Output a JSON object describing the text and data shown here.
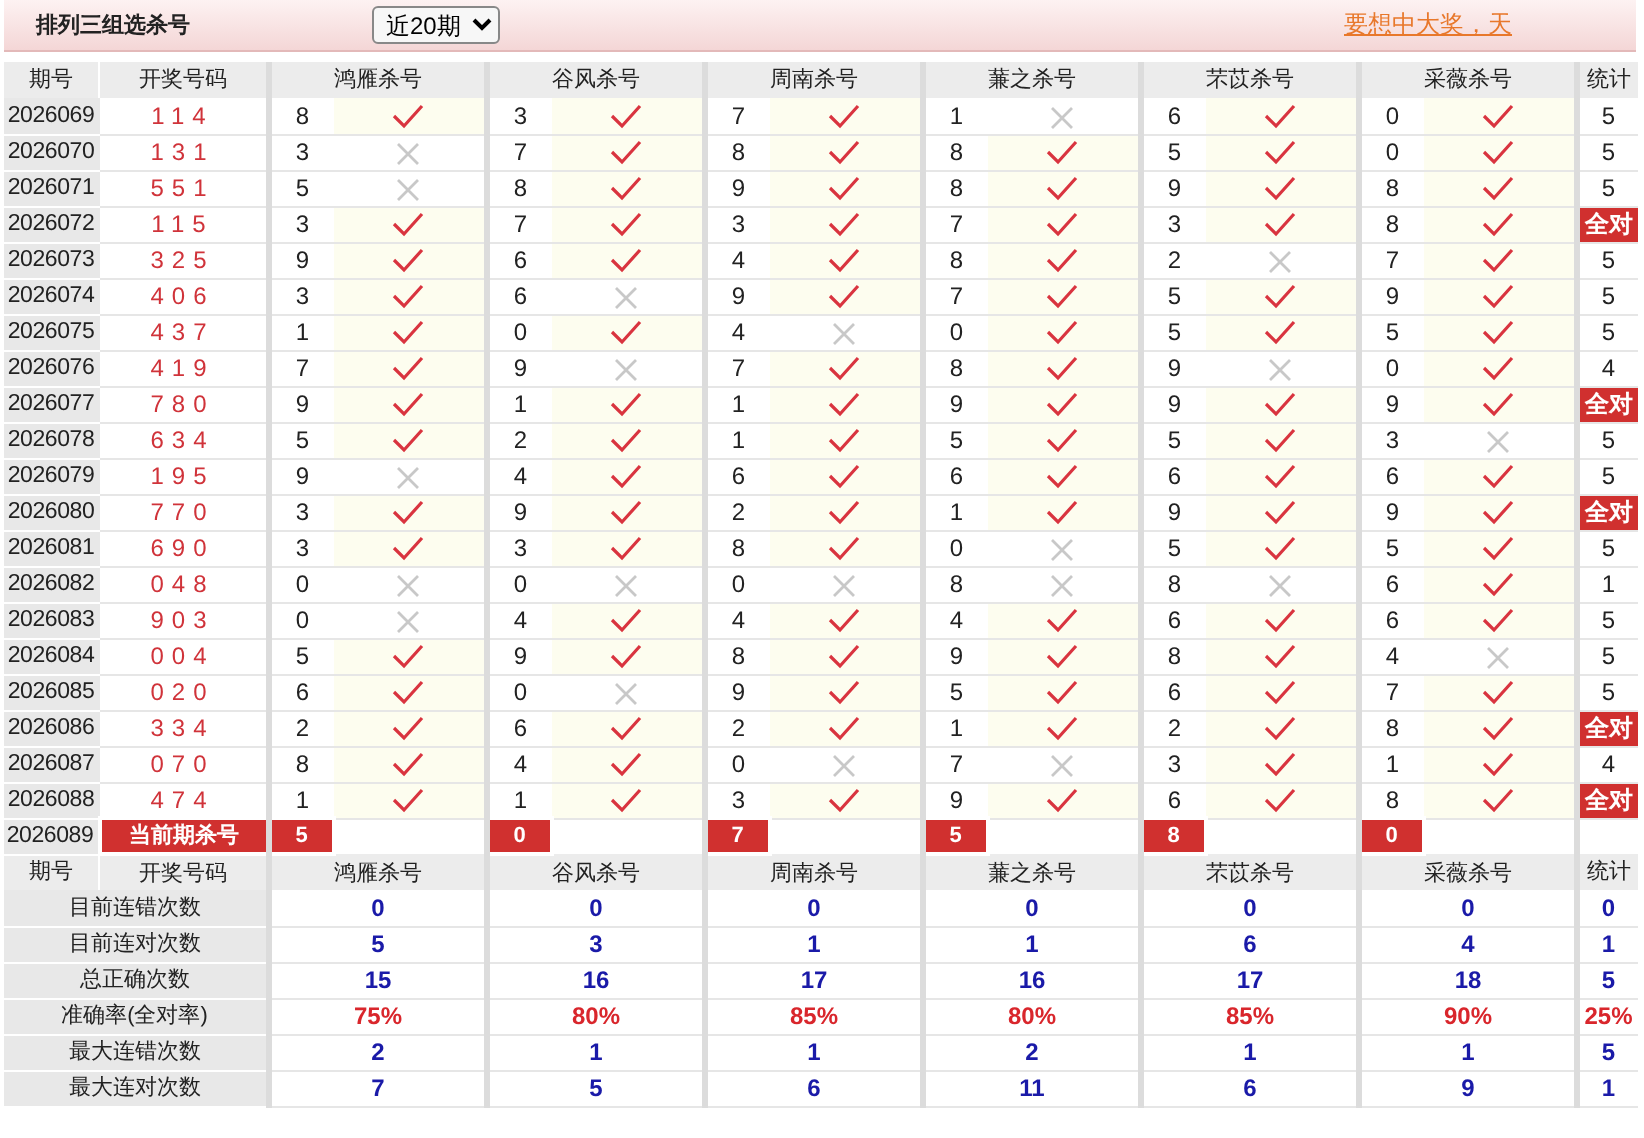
{
  "title": "排列三组选杀号",
  "period_select": {
    "value": "近20期"
  },
  "promo_link": "要想中大奖，天",
  "table": {
    "columns": [
      "期号",
      "开奖号码",
      "鸿雁杀号",
      "谷风杀号",
      "周南杀号",
      "蒹之杀号",
      "芣苡杀号",
      "采薇杀号",
      "统计"
    ],
    "rows": [
      {
        "period": "2026069",
        "draw": "114",
        "kills": [
          {
            "number": "8",
            "hit": true
          },
          {
            "number": "3",
            "hit": true
          },
          {
            "number": "7",
            "hit": true
          },
          {
            "number": "1",
            "hit": false
          },
          {
            "number": "6",
            "hit": true
          },
          {
            "number": "0",
            "hit": true
          }
        ],
        "stat": "5",
        "stat_highlight": false
      },
      {
        "period": "2026070",
        "draw": "131",
        "kills": [
          {
            "number": "3",
            "hit": false
          },
          {
            "number": "7",
            "hit": true
          },
          {
            "number": "8",
            "hit": true
          },
          {
            "number": "8",
            "hit": true
          },
          {
            "number": "5",
            "hit": true
          },
          {
            "number": "0",
            "hit": true
          }
        ],
        "stat": "5",
        "stat_highlight": false
      },
      {
        "period": "2026071",
        "draw": "551",
        "kills": [
          {
            "number": "5",
            "hit": false
          },
          {
            "number": "8",
            "hit": true
          },
          {
            "number": "9",
            "hit": true
          },
          {
            "number": "8",
            "hit": true
          },
          {
            "number": "9",
            "hit": true
          },
          {
            "number": "8",
            "hit": true
          }
        ],
        "stat": "5",
        "stat_highlight": false
      },
      {
        "period": "2026072",
        "draw": "115",
        "kills": [
          {
            "number": "3",
            "hit": true
          },
          {
            "number": "7",
            "hit": true
          },
          {
            "number": "3",
            "hit": true
          },
          {
            "number": "7",
            "hit": true
          },
          {
            "number": "3",
            "hit": true
          },
          {
            "number": "8",
            "hit": true
          }
        ],
        "stat": "全对",
        "stat_highlight": true
      },
      {
        "period": "2026073",
        "draw": "325",
        "kills": [
          {
            "number": "9",
            "hit": true
          },
          {
            "number": "6",
            "hit": true
          },
          {
            "number": "4",
            "hit": true
          },
          {
            "number": "8",
            "hit": true
          },
          {
            "number": "2",
            "hit": false
          },
          {
            "number": "7",
            "hit": true
          }
        ],
        "stat": "5",
        "stat_highlight": false
      },
      {
        "period": "2026074",
        "draw": "406",
        "kills": [
          {
            "number": "3",
            "hit": true
          },
          {
            "number": "6",
            "hit": false
          },
          {
            "number": "9",
            "hit": true
          },
          {
            "number": "7",
            "hit": true
          },
          {
            "number": "5",
            "hit": true
          },
          {
            "number": "9",
            "hit": true
          }
        ],
        "stat": "5",
        "stat_highlight": false
      },
      {
        "period": "2026075",
        "draw": "437",
        "kills": [
          {
            "number": "1",
            "hit": true
          },
          {
            "number": "0",
            "hit": true
          },
          {
            "number": "4",
            "hit": false
          },
          {
            "number": "0",
            "hit": true
          },
          {
            "number": "5",
            "hit": true
          },
          {
            "number": "5",
            "hit": true
          }
        ],
        "stat": "5",
        "stat_highlight": false
      },
      {
        "period": "2026076",
        "draw": "419",
        "kills": [
          {
            "number": "7",
            "hit": true
          },
          {
            "number": "9",
            "hit": false
          },
          {
            "number": "7",
            "hit": true
          },
          {
            "number": "8",
            "hit": true
          },
          {
            "number": "9",
            "hit": false
          },
          {
            "number": "0",
            "hit": true
          }
        ],
        "stat": "4",
        "stat_highlight": false
      },
      {
        "period": "2026077",
        "draw": "780",
        "kills": [
          {
            "number": "9",
            "hit": true
          },
          {
            "number": "1",
            "hit": true
          },
          {
            "number": "1",
            "hit": true
          },
          {
            "number": "9",
            "hit": true
          },
          {
            "number": "9",
            "hit": true
          },
          {
            "number": "9",
            "hit": true
          }
        ],
        "stat": "全对",
        "stat_highlight": true
      },
      {
        "period": "2026078",
        "draw": "634",
        "kills": [
          {
            "number": "5",
            "hit": true
          },
          {
            "number": "2",
            "hit": true
          },
          {
            "number": "1",
            "hit": true
          },
          {
            "number": "5",
            "hit": true
          },
          {
            "number": "5",
            "hit": true
          },
          {
            "number": "3",
            "hit": false
          }
        ],
        "stat": "5",
        "stat_highlight": false
      },
      {
        "period": "2026079",
        "draw": "195",
        "kills": [
          {
            "number": "9",
            "hit": false
          },
          {
            "number": "4",
            "hit": true
          },
          {
            "number": "6",
            "hit": true
          },
          {
            "number": "6",
            "hit": true
          },
          {
            "number": "6",
            "hit": true
          },
          {
            "number": "6",
            "hit": true
          }
        ],
        "stat": "5",
        "stat_highlight": false
      },
      {
        "period": "2026080",
        "draw": "770",
        "kills": [
          {
            "number": "3",
            "hit": true
          },
          {
            "number": "9",
            "hit": true
          },
          {
            "number": "2",
            "hit": true
          },
          {
            "number": "1",
            "hit": true
          },
          {
            "number": "9",
            "hit": true
          },
          {
            "number": "9",
            "hit": true
          }
        ],
        "stat": "全对",
        "stat_highlight": true
      },
      {
        "period": "2026081",
        "draw": "690",
        "kills": [
          {
            "number": "3",
            "hit": true
          },
          {
            "number": "3",
            "hit": true
          },
          {
            "number": "8",
            "hit": true
          },
          {
            "number": "0",
            "hit": false
          },
          {
            "number": "5",
            "hit": true
          },
          {
            "number": "5",
            "hit": true
          }
        ],
        "stat": "5",
        "stat_highlight": false
      },
      {
        "period": "2026082",
        "draw": "048",
        "kills": [
          {
            "number": "0",
            "hit": false
          },
          {
            "number": "0",
            "hit": false
          },
          {
            "number": "0",
            "hit": false
          },
          {
            "number": "8",
            "hit": false
          },
          {
            "number": "8",
            "hit": false
          },
          {
            "number": "6",
            "hit": true
          }
        ],
        "stat": "1",
        "stat_highlight": false
      },
      {
        "period": "2026083",
        "draw": "903",
        "kills": [
          {
            "number": "0",
            "hit": false
          },
          {
            "number": "4",
            "hit": true
          },
          {
            "number": "4",
            "hit": true
          },
          {
            "number": "4",
            "hit": true
          },
          {
            "number": "6",
            "hit": true
          },
          {
            "number": "6",
            "hit": true
          }
        ],
        "stat": "5",
        "stat_highlight": false
      },
      {
        "period": "2026084",
        "draw": "004",
        "kills": [
          {
            "number": "5",
            "hit": true
          },
          {
            "number": "9",
            "hit": true
          },
          {
            "number": "8",
            "hit": true
          },
          {
            "number": "9",
            "hit": true
          },
          {
            "number": "8",
            "hit": true
          },
          {
            "number": "4",
            "hit": false
          }
        ],
        "stat": "5",
        "stat_highlight": false
      },
      {
        "period": "2026085",
        "draw": "020",
        "kills": [
          {
            "number": "6",
            "hit": true
          },
          {
            "number": "0",
            "hit": false
          },
          {
            "number": "9",
            "hit": true
          },
          {
            "number": "5",
            "hit": true
          },
          {
            "number": "6",
            "hit": true
          },
          {
            "number": "7",
            "hit": true
          }
        ],
        "stat": "5",
        "stat_highlight": false
      },
      {
        "period": "2026086",
        "draw": "334",
        "kills": [
          {
            "number": "2",
            "hit": true
          },
          {
            "number": "6",
            "hit": true
          },
          {
            "number": "2",
            "hit": true
          },
          {
            "number": "1",
            "hit": true
          },
          {
            "number": "2",
            "hit": true
          },
          {
            "number": "8",
            "hit": true
          }
        ],
        "stat": "全对",
        "stat_highlight": true
      },
      {
        "period": "2026087",
        "draw": "070",
        "kills": [
          {
            "number": "8",
            "hit": true
          },
          {
            "number": "4",
            "hit": true
          },
          {
            "number": "0",
            "hit": false
          },
          {
            "number": "7",
            "hit": false
          },
          {
            "number": "3",
            "hit": true
          },
          {
            "number": "1",
            "hit": true
          }
        ],
        "stat": "4",
        "stat_highlight": false
      },
      {
        "period": "2026088",
        "draw": "474",
        "kills": [
          {
            "number": "1",
            "hit": true
          },
          {
            "number": "1",
            "hit": true
          },
          {
            "number": "3",
            "hit": true
          },
          {
            "number": "9",
            "hit": true
          },
          {
            "number": "6",
            "hit": true
          },
          {
            "number": "8",
            "hit": true
          }
        ],
        "stat": "全对",
        "stat_highlight": true
      }
    ],
    "current": {
      "period": "2026089",
      "label": "当前期杀号",
      "kills": [
        "5",
        "0",
        "7",
        "5",
        "8",
        "0"
      ]
    }
  },
  "summary": {
    "columns": [
      "期号",
      "开奖号码",
      "鸿雁杀号",
      "谷风杀号",
      "周南杀号",
      "蒹之杀号",
      "芣苡杀号",
      "采薇杀号",
      "统计"
    ],
    "rows": [
      {
        "label": "目前连错次数",
        "kind": "count",
        "values": [
          "0",
          "0",
          "0",
          "0",
          "0",
          "0",
          "0"
        ]
      },
      {
        "label": "目前连对次数",
        "kind": "count",
        "values": [
          "5",
          "3",
          "1",
          "1",
          "6",
          "4",
          "1"
        ]
      },
      {
        "label": "总正确次数",
        "kind": "count",
        "values": [
          "15",
          "16",
          "17",
          "16",
          "17",
          "18",
          "5"
        ]
      },
      {
        "label": "准确率(全对率)",
        "kind": "rate",
        "values": [
          "75%",
          "80%",
          "85%",
          "80%",
          "85%",
          "90%",
          "25%"
        ]
      },
      {
        "label": "最大连错次数",
        "kind": "count",
        "values": [
          "2",
          "1",
          "1",
          "2",
          "1",
          "1",
          "5"
        ]
      },
      {
        "label": "最大连对次数",
        "kind": "count",
        "values": [
          "7",
          "5",
          "6",
          "11",
          "6",
          "9",
          "1"
        ]
      }
    ]
  }
}
